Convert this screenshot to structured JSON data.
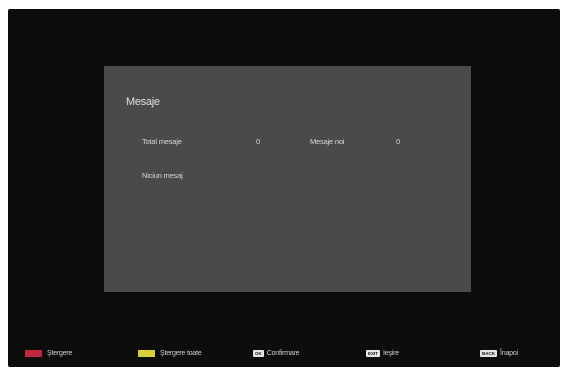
{
  "panel": {
    "title": "Mesaje",
    "total_label": "Total mesaje",
    "total_value": "0",
    "new_label": "Mesaje noi",
    "new_value": "0",
    "empty_text": "Niciun mesaj"
  },
  "footer": {
    "items": [
      {
        "label": "Ştergere",
        "key": "",
        "color": "#c0263d"
      },
      {
        "label": "Ştergere toate",
        "key": "",
        "color": "#d4cf3a"
      },
      {
        "label": "Confirmare",
        "key": "OK"
      },
      {
        "label": "Ieşire",
        "key": "EXIT"
      },
      {
        "label": "Înapoi",
        "key": "BACK"
      }
    ]
  }
}
